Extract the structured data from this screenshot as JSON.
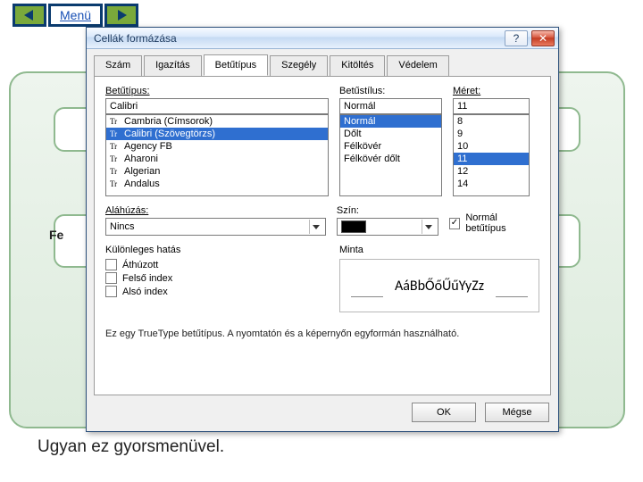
{
  "nav": {
    "menu_label": "Menü"
  },
  "bg": {
    "truncated_label": "Fe"
  },
  "dialog": {
    "title": "Cellák formázása",
    "help_glyph": "?",
    "close_glyph": "✕",
    "tabs": [
      "Szám",
      "Igazítás",
      "Betűtípus",
      "Szegély",
      "Kitöltés",
      "Védelem"
    ],
    "active_tab_index": 2,
    "buttons": {
      "ok": "OK",
      "cancel": "Mégse"
    }
  },
  "font_panel": {
    "labels": {
      "font": "Betűtípus:",
      "style": "Betűstílus:",
      "size": "Méret:",
      "underline": "Aláhúzás:",
      "color": "Szín:",
      "normal_font": "Normál betűtípus",
      "effects": "Különleges hatás",
      "preview": "Minta",
      "strikethrough": "Áthúzott",
      "superscript": "Felső index",
      "subscript": "Alsó index"
    },
    "font_input": "Calibri",
    "font_list": [
      "Cambria (Címsorok)",
      "Calibri (Szövegtörzs)",
      "Agency FB",
      "Aharoni",
      "Algerian",
      "Andalus"
    ],
    "font_selected_index": 1,
    "style_input": "Normál",
    "style_list": [
      "Normál",
      "Dőlt",
      "Félkövér",
      "Félkövér dőlt"
    ],
    "style_selected_index": 0,
    "size_input": "11",
    "size_list": [
      "8",
      "9",
      "10",
      "11",
      "12",
      "14"
    ],
    "size_selected_index": 3,
    "underline_value": "Nincs",
    "color_hex": "#000000",
    "normal_font_checked": true,
    "effects_checked": {
      "strike": false,
      "super": false,
      "sub": false
    },
    "preview_text": "AáBbŐőŰűYyZz",
    "note": "Ez egy TrueType betűtípus.  A nyomtatón és a képernyőn egyformán használható."
  },
  "caption": "Ugyan ez gyorsmenüvel."
}
